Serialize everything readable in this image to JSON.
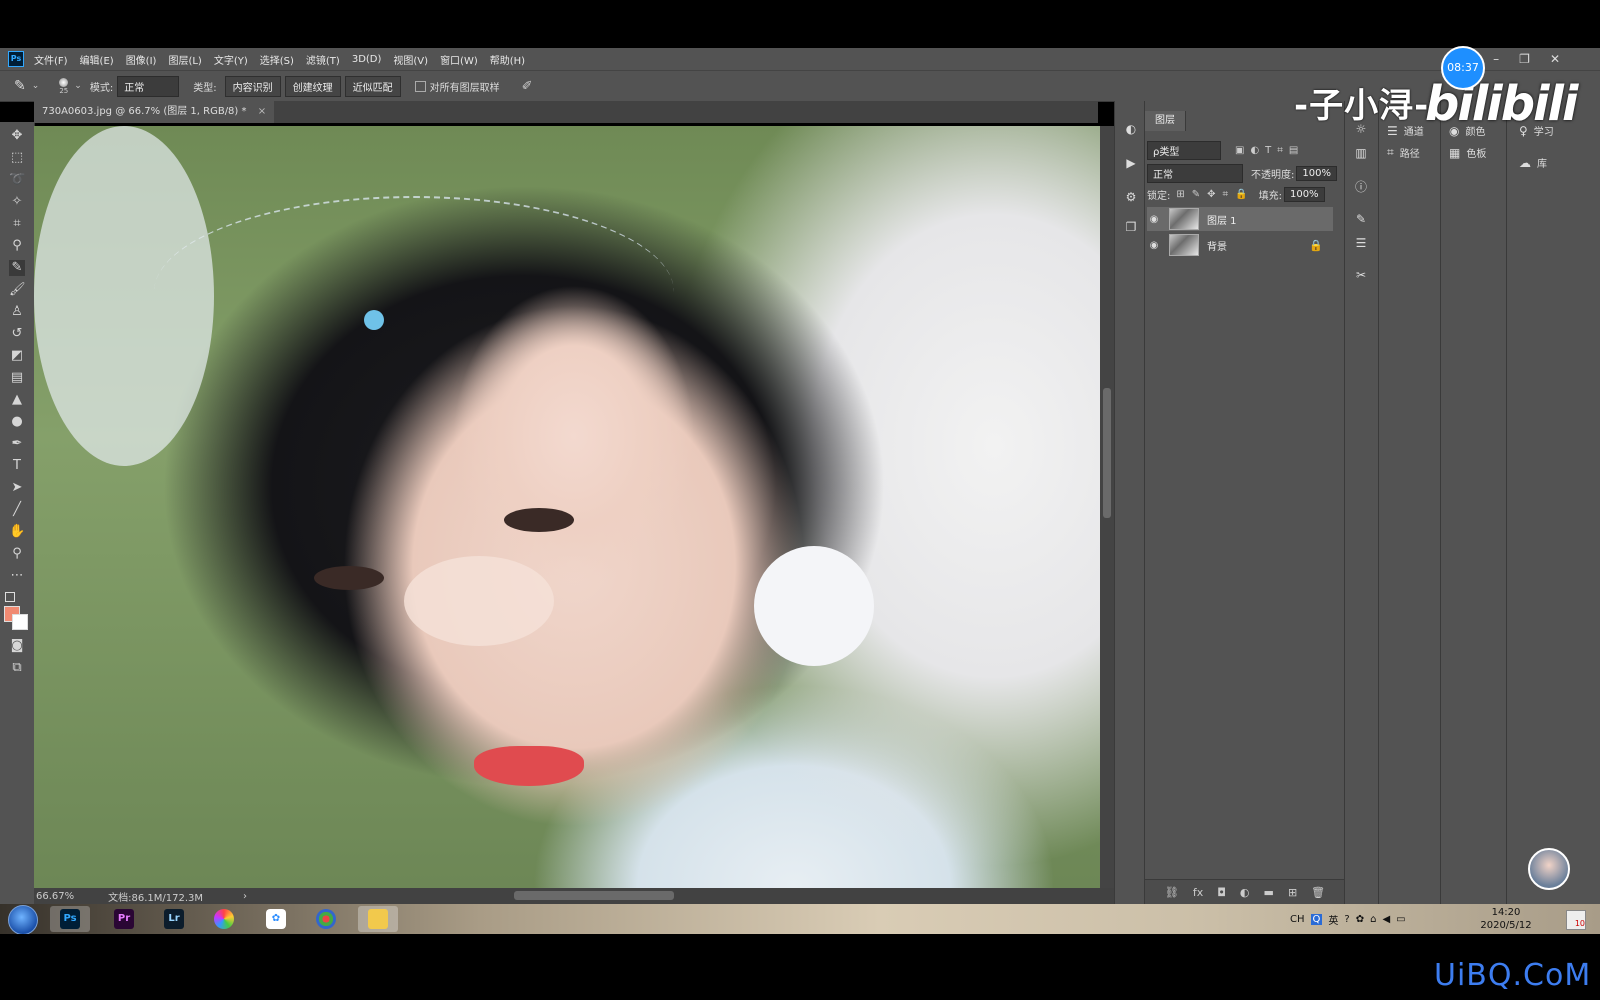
{
  "app": {
    "logo": "Ps"
  },
  "menu": [
    "文件(F)",
    "编辑(E)",
    "图像(I)",
    "图层(L)",
    "文字(Y)",
    "选择(S)",
    "滤镜(T)",
    "3D(D)",
    "视图(V)",
    "窗口(W)",
    "帮助(H)"
  ],
  "options": {
    "brush_size": "25",
    "mode_label": "模式:",
    "mode_value": "正常",
    "type_label": "类型:",
    "type_buttons": [
      "内容识别",
      "创建纹理",
      "近似匹配"
    ],
    "sample_all_label": "对所有图层取样"
  },
  "document_tab": {
    "title": "730A0603.jpg @ 66.7% (图层 1, RGB/8) *",
    "close": "×"
  },
  "status": {
    "zoom": "66.67%",
    "doc_size": "文档:86.1M/172.3M",
    "arrow": "›"
  },
  "layers_panel": {
    "tab": "图层",
    "filter_value": "ρ类型",
    "blend_mode": "正常",
    "opacity_label": "不透明度:",
    "opacity_value": "100%",
    "lock_label": "锁定:",
    "fill_label": "填充:",
    "fill_value": "100%",
    "layers": [
      {
        "name": "图层 1",
        "selected": true
      },
      {
        "name": "背景",
        "locked": true
      }
    ]
  },
  "side_panels": {
    "channels": "通道",
    "paths": "路径",
    "color": "颜色",
    "swatches": "色板",
    "learn": "学习",
    "library": "库"
  },
  "overlay": {
    "timer": "08:37",
    "uploader": "-子小浔-",
    "bili": "bilibili"
  },
  "taskbar": {
    "apps": [
      "Ps",
      "Pr",
      "Lr"
    ],
    "tray_lang": "CH",
    "tray_ime": "英",
    "clock_time": "14:20",
    "clock_date": "2020/5/12",
    "notify_count": "10"
  },
  "site_watermark": "UiBQ.CoM",
  "colors": {
    "ui_bg": "#535353",
    "ui_dark": "#424242",
    "accent_blue": "#1e8fff",
    "foreground_swatch": "#f08a72"
  }
}
